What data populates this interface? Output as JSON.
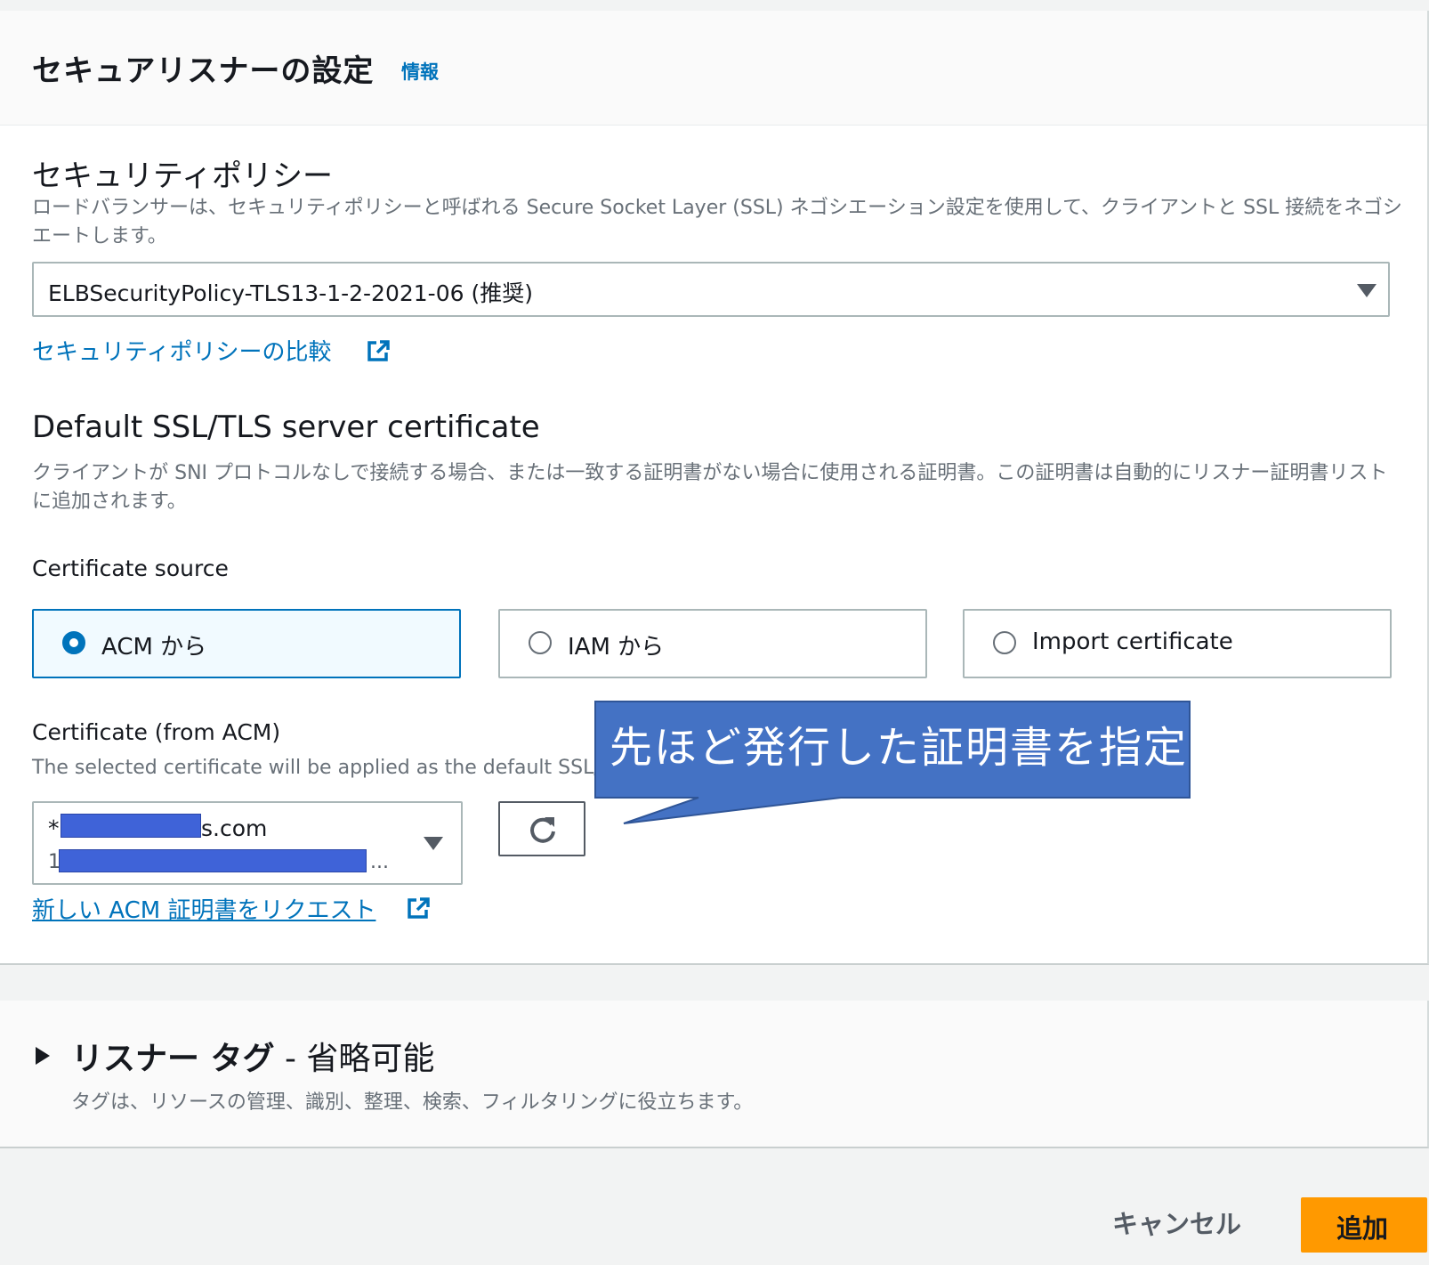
{
  "header": {
    "title": "セキュアリスナーの設定",
    "info_link": "情報"
  },
  "security_policy": {
    "title": "セキュリティポリシー",
    "description": "ロードバランサーは、セキュリティポリシーと呼ばれる Secure Socket Layer (SSL) ネゴシエーション設定を使用して、クライアントと SSL 接続をネゴシエートします。",
    "selected_value": "ELBSecurityPolicy-TLS13-1-2-2021-06 (推奨)",
    "compare_link": "セキュリティポリシーの比較"
  },
  "default_cert": {
    "title": "Default SSL/TLS server certificate",
    "description": "クライアントが SNI プロトコルなしで接続する場合、または一致する証明書がない場合に使用される証明書。この証明書は自動的にリスナー証明書リストに追加されます。"
  },
  "certificate_source": {
    "label": "Certificate source",
    "options": [
      {
        "label": "ACM から",
        "selected": true
      },
      {
        "label": "IAM から",
        "selected": false
      },
      {
        "label": "Import certificate",
        "selected": false
      }
    ]
  },
  "certificate_acm": {
    "label": "Certificate (from ACM)",
    "description": "The selected certificate will be applied as the default SSL/",
    "line1_prefix": "*",
    "line1_suffix": "s.com",
    "line2_prefix": "1",
    "line2_suffix": "...",
    "request_link": "新しい ACM 証明書をリクエスト"
  },
  "callout": {
    "text": "先ほど発行した証明書を指定",
    "fill": "#4472c4",
    "border": "#2f5597"
  },
  "listener_tags": {
    "title_bold": "リスナー タグ",
    "title_suffix": " - 省略可能",
    "description": "タグは、リソースの管理、識別、整理、検索、フィルタリングに役立ちます。"
  },
  "footer": {
    "cancel_label": "キャンセル",
    "add_label": "追加"
  },
  "colors": {
    "link": "#0073bb",
    "primary_button": "#ff9900",
    "redaction": "#3f63d8"
  }
}
